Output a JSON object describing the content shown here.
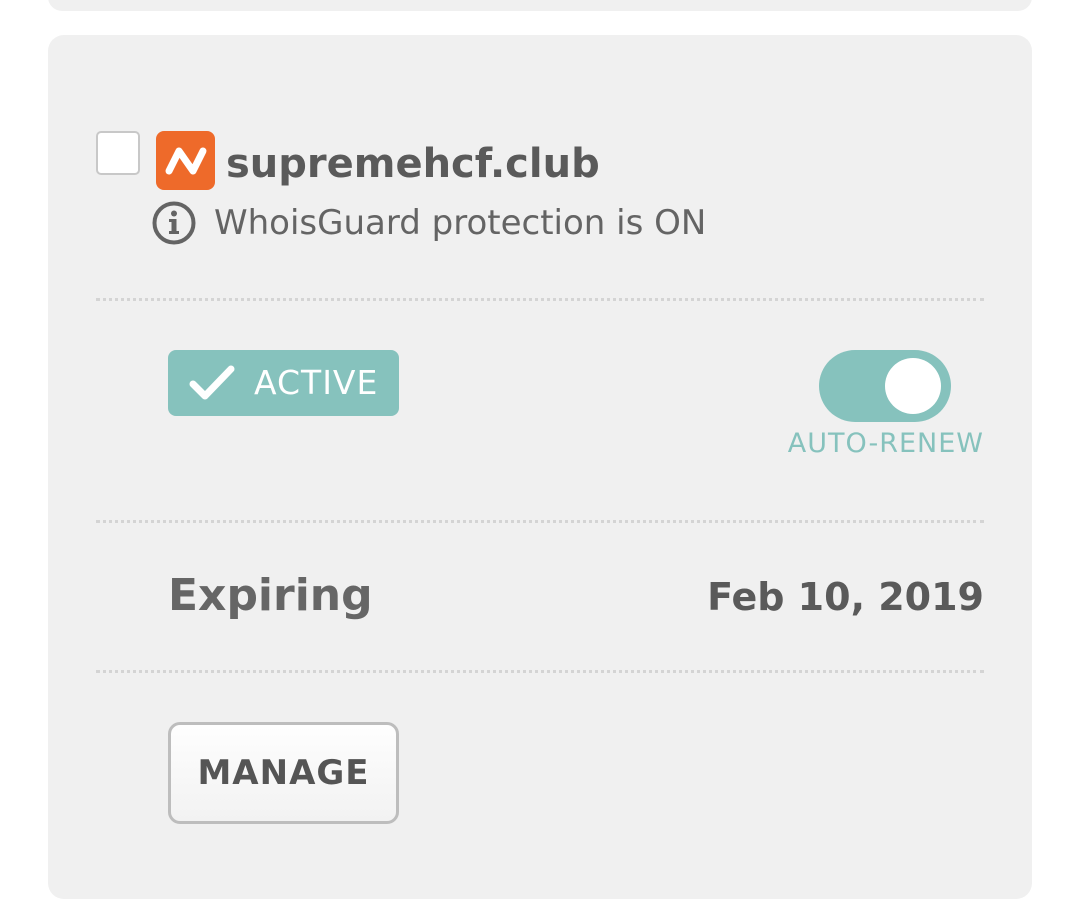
{
  "domain": {
    "name": "supremehcf.club",
    "privacy_notice": "WhoisGuard protection is ON"
  },
  "status": {
    "label": "ACTIVE"
  },
  "auto_renew": {
    "label": "AUTO-RENEW",
    "enabled": true
  },
  "expiration": {
    "label": "Expiring",
    "date": "Feb 10, 2019"
  },
  "actions": {
    "manage_label": "MANAGE"
  },
  "icons": {
    "brand": "namecheap-logo-icon",
    "info": "info-circle-icon",
    "check": "checkmark-icon"
  },
  "colors": {
    "accent": "#86c2bd",
    "brand": "#ee6a2a",
    "card_background": "#f0f0f0",
    "text": "#5a5a5a"
  }
}
